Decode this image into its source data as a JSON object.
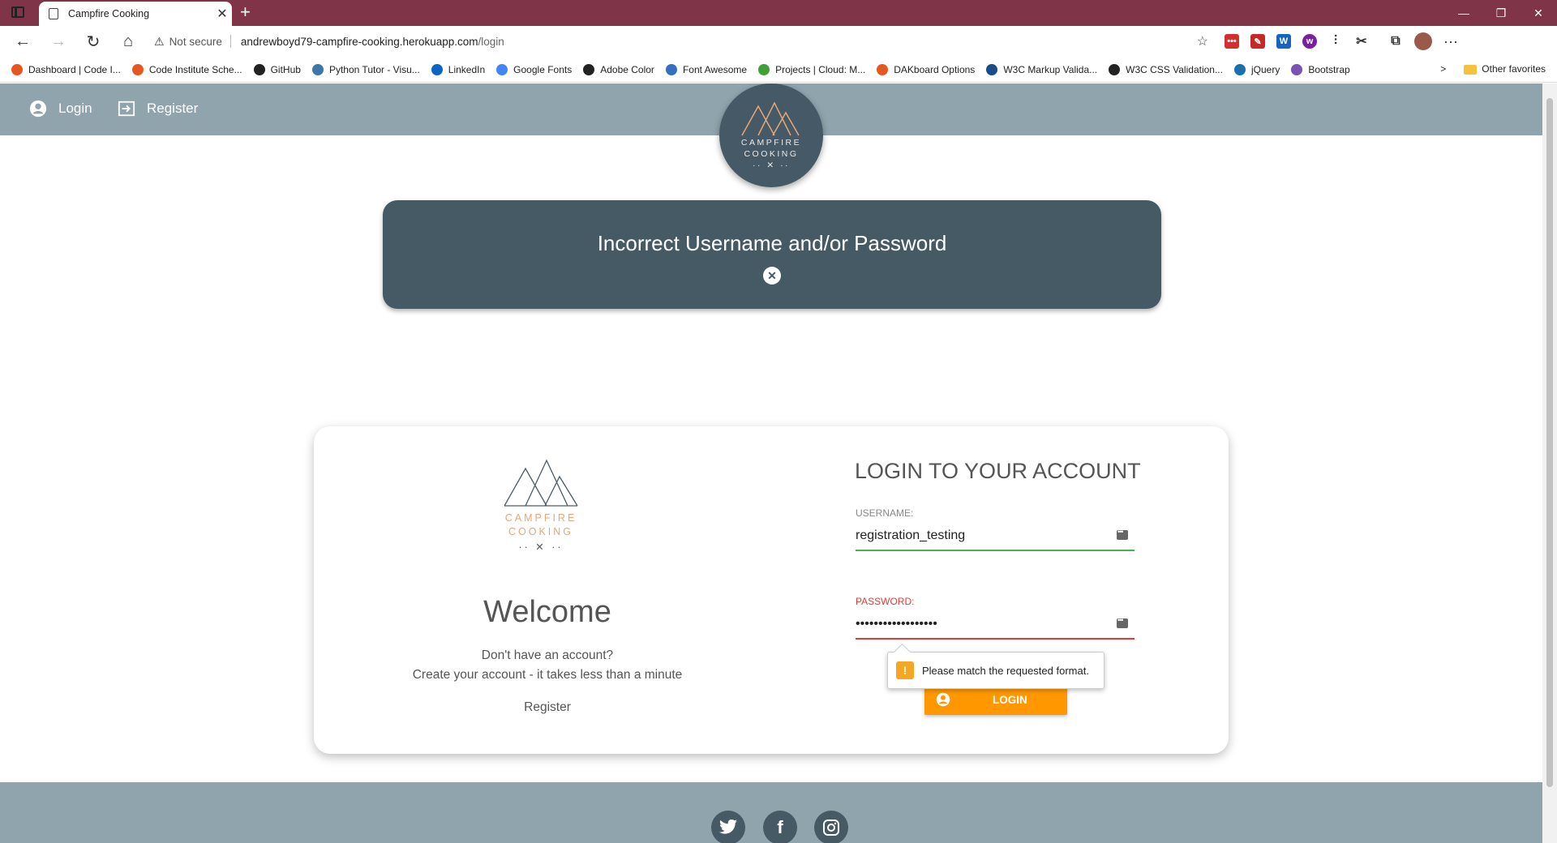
{
  "browser": {
    "tab_title": "Campfire Cooking",
    "new_tab": "+",
    "security": "Not secure",
    "url_host": "andrewboyd79-campfire-cooking.herokuapp.com",
    "url_path": "/login",
    "bookmarks": [
      {
        "label": "Dashboard | Code I...",
        "color": "#e8561f"
      },
      {
        "label": "Code Institute Sche...",
        "color": "#e8561f"
      },
      {
        "label": "GitHub",
        "color": "#222222"
      },
      {
        "label": "Python Tutor - Visu...",
        "color": "#3b77a8"
      },
      {
        "label": "LinkedIn",
        "color": "#0a66c2"
      },
      {
        "label": "Google Fonts",
        "color": "#4285f4"
      },
      {
        "label": "Adobe Color",
        "color": "#222222"
      },
      {
        "label": "Font Awesome",
        "color": "#3370c2"
      },
      {
        "label": "Projects | Cloud: M...",
        "color": "#3fa037"
      },
      {
        "label": "DAKboard Options",
        "color": "#e8561f"
      },
      {
        "label": "W3C Markup Valida...",
        "color": "#1a4c8a"
      },
      {
        "label": "W3C CSS Validation...",
        "color": "#222222"
      },
      {
        "label": "jQuery",
        "color": "#1a6fb0"
      },
      {
        "label": "Bootstrap",
        "color": "#7952b3"
      }
    ],
    "other_favorites": "Other favorites"
  },
  "nav": {
    "login": "Login",
    "register": "Register",
    "logo_line1": "CAMPFIRE",
    "logo_line2": "COOKING"
  },
  "flash": {
    "message": "Incorrect Username and/or Password"
  },
  "card": {
    "logo_line1": "CAMPFIRE",
    "logo_line2": "COOKING",
    "welcome": "Welcome",
    "sub1": "Don't have an account?",
    "sub2": "Create your account - it takes less than a minute",
    "register_link": "Register",
    "title": "LOGIN TO YOUR ACCOUNT",
    "username_label": "USERNAME:",
    "username_value": "registration_testing",
    "password_label": "PASSWORD:",
    "password_value": "••••••••••••••••••",
    "tooltip": "Please match the requested format.",
    "login_button": "LOGIN"
  },
  "colors": {
    "tabbar": "#7f3547",
    "nav": "#8fa4ad",
    "flash": "#465a66",
    "accent": "#ff9800"
  }
}
